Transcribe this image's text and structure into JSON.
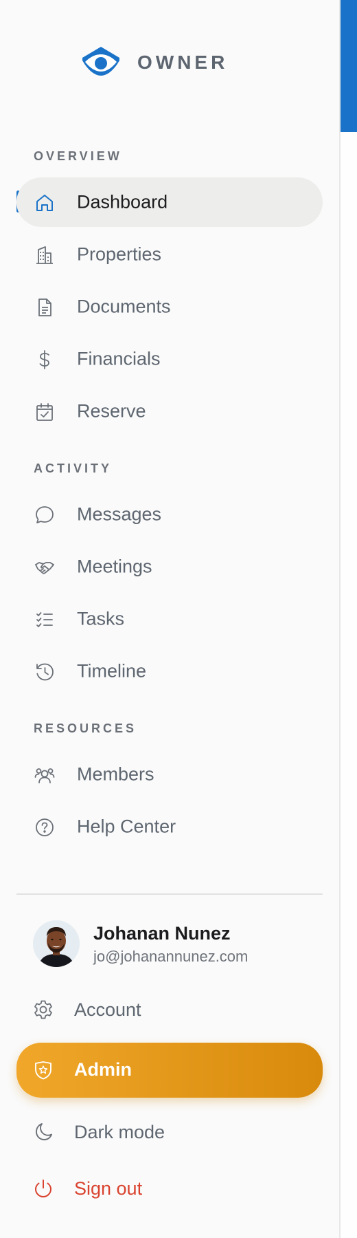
{
  "brand": {
    "name": "OWNER",
    "accent": "#1a73c8"
  },
  "sections": {
    "overview": {
      "label": "OVERVIEW",
      "items": [
        {
          "label": "Dashboard",
          "icon": "home-icon",
          "active": true
        },
        {
          "label": "Properties",
          "icon": "building-icon"
        },
        {
          "label": "Documents",
          "icon": "document-icon"
        },
        {
          "label": "Financials",
          "icon": "dollar-icon"
        },
        {
          "label": "Reserve",
          "icon": "calendar-check-icon"
        }
      ]
    },
    "activity": {
      "label": "ACTIVITY",
      "items": [
        {
          "label": "Messages",
          "icon": "chat-bubble-icon"
        },
        {
          "label": "Meetings",
          "icon": "handshake-icon"
        },
        {
          "label": "Tasks",
          "icon": "checklist-icon"
        },
        {
          "label": "Timeline",
          "icon": "history-icon"
        }
      ]
    },
    "resources": {
      "label": "RESOURCES",
      "items": [
        {
          "label": "Members",
          "icon": "users-icon"
        },
        {
          "label": "Help Center",
          "icon": "help-circle-icon"
        }
      ]
    }
  },
  "user": {
    "name": "Johanan Nunez",
    "email": "jo@johanannunez.com"
  },
  "actions": {
    "account": {
      "label": "Account",
      "icon": "gear-icon"
    },
    "admin": {
      "label": "Admin",
      "icon": "shield-star-icon",
      "color": "#e89a1c"
    },
    "dark_mode": {
      "label": "Dark mode",
      "icon": "moon-icon"
    },
    "sign_out": {
      "label": "Sign out",
      "icon": "power-icon",
      "color": "#d9432f"
    }
  }
}
